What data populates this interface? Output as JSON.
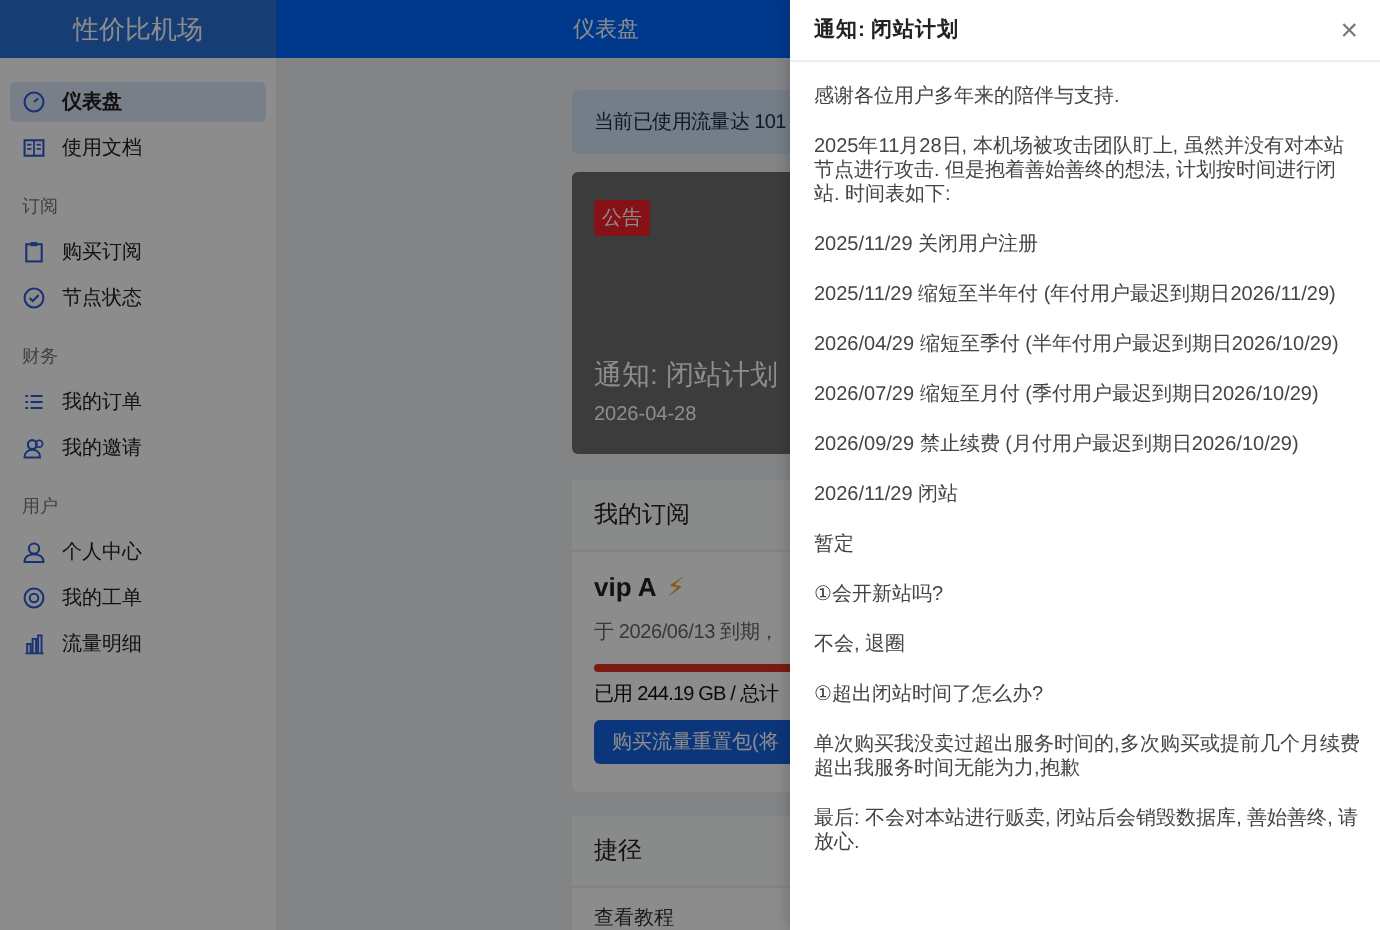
{
  "sidebar": {
    "brand": "性价比机场",
    "top_items": [
      {
        "label": "仪表盘",
        "selected": true
      },
      {
        "label": "使用文档",
        "selected": false
      }
    ],
    "sections": [
      {
        "title": "订阅",
        "items": [
          {
            "label": "购买订阅",
            "selected": false
          },
          {
            "label": "节点状态",
            "selected": false
          }
        ]
      },
      {
        "title": "财务",
        "items": [
          {
            "label": "我的订单",
            "selected": false
          },
          {
            "label": "我的邀请",
            "selected": false
          }
        ]
      },
      {
        "title": "用户",
        "items": [
          {
            "label": "个人中心",
            "selected": false
          },
          {
            "label": "我的工单",
            "selected": false
          },
          {
            "label": "流量明细",
            "selected": false
          }
        ]
      }
    ]
  },
  "header": {
    "title": "仪表盘"
  },
  "main": {
    "alert": "当前已使用流量达 101",
    "notice_card": {
      "badge": "公告",
      "title": "通知: 闭站计划",
      "date": "2026-04-28"
    },
    "subscription": {
      "heading": "我的订阅",
      "plan": "vip A",
      "plan_icon": "⚡",
      "expiry": "于 2026/06/13 到期，",
      "usage_bar": {
        "level": 1
      },
      "usage": "已用 244.19 GB / 总计",
      "button": "购买流量重置包(将"
    },
    "shortcuts": {
      "heading": "捷径",
      "items": [
        "查看教程"
      ]
    }
  },
  "drawer": {
    "title": "通知: 闭站计划",
    "close": "×",
    "paragraphs": [
      "感谢各位用户多年来的陪伴与支持.",
      "2025年11月28日, 本机场被攻击团队盯上, 虽然并没有对本站节点进行攻击. 但是抱着善始善终的想法, 计划按时间进行闭站. 时间表如下:",
      "2025/11/29 关闭用户注册",
      "2025/11/29 缩短至半年付 (年付用户最迟到期日2026/11/29)",
      "2026/04/29 缩短至季付 (半年付用户最迟到期日2026/10/29)",
      "2026/07/29 缩短至月付 (季付用户最迟到期日2026/10/29)",
      "2026/09/29 禁止续费 (月付用户最迟到期日2026/10/29)",
      "2026/11/29 闭站",
      "暂定",
      "①会开新站吗?",
      "不会, 退圈",
      "①超出闭站时间了怎么办?",
      "单次购买我没卖过超出服务时间的,多次购买或提前几个月续费超出我服务时间无能为力,抱歉",
      "最后: 不会对本站进行贩卖, 闭站后会销毁数据库, 善始善终, 请放心."
    ]
  }
}
